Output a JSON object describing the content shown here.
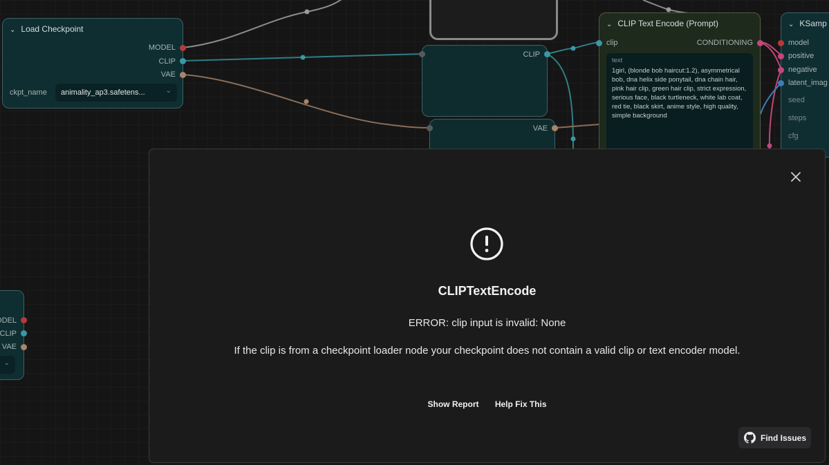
{
  "nodes": {
    "load_checkpoint": {
      "title": "Load Checkpoint",
      "outputs": [
        "MODEL",
        "CLIP",
        "VAE"
      ],
      "widget_label": "ckpt_name",
      "widget_value": "animality_ap3.safetens..."
    },
    "reroute_middle": {
      "output_clip": "CLIP",
      "output_vae": "VAE"
    },
    "clip_text_encode": {
      "title": "CLIP Text Encode (Prompt)",
      "input": "clip",
      "output": "CONDITIONING",
      "text_label": "text",
      "text_value": "1girl, (blonde bob haircut:1.2), asymmetrical bob, dna helix side ponytail, dna chain hair, pink hair clip, green hair clip, strict expression, serious face, black turtleneck, white lab coat, red tie, black skirt, anime style, high quality, simple background"
    },
    "ksampler": {
      "title": "KSamp",
      "inputs": [
        "model",
        "positive",
        "negative",
        "latent_imag"
      ],
      "widgets": [
        "seed",
        "steps",
        "cfg"
      ]
    },
    "left_partial": {
      "outputs": [
        "ODEL",
        "CLIP",
        "VAE"
      ]
    }
  },
  "modal": {
    "title": "CLIPTextEncode",
    "error": "ERROR: clip input is invalid: None",
    "description": "If the clip is from a checkpoint loader node your checkpoint does not contain a valid clip or text encoder model.",
    "show_report": "Show Report",
    "help_fix": "Help Fix This",
    "find_issues": "Find Issues"
  },
  "colors": {
    "model": "#b8393b",
    "clip": "#3a98a3",
    "vae": "#a9846a",
    "conditioning": "#c2477a",
    "latent": "#3a7fb6"
  }
}
